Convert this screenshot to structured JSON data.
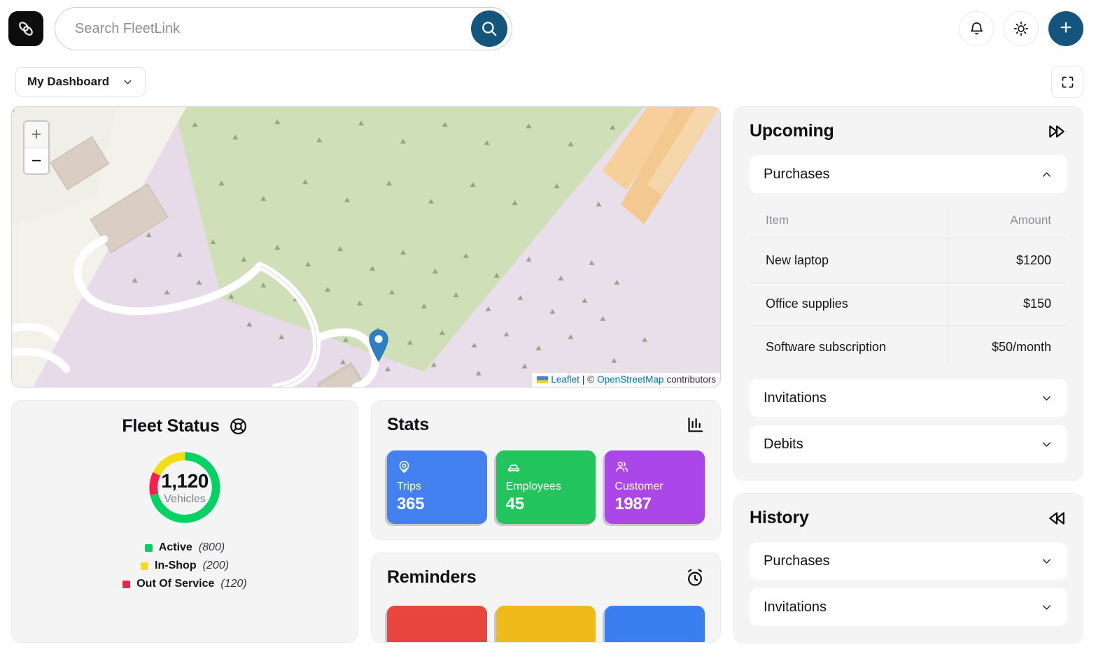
{
  "app": {
    "logo_icon": "chain-link-icon",
    "accent_dark": "#14557e"
  },
  "search": {
    "placeholder": "Search FleetLink",
    "value": "",
    "button_icon": "search-icon"
  },
  "header_actions": [
    {
      "name": "notifications",
      "icon": "bell-icon"
    },
    {
      "name": "theme-toggle",
      "icon": "sun-icon"
    },
    {
      "name": "add",
      "icon": "plus-icon",
      "label": "+"
    }
  ],
  "subheader": {
    "dashboard_select": "My Dashboard",
    "chevron_icon": "chevron-down-icon",
    "fullscreen_icon": "fullscreen-icon"
  },
  "map": {
    "zoom_in": "+",
    "zoom_out": "−",
    "marker_icon": "map-pin-marker",
    "attribution": {
      "flag_icon": "ukraine-flag-icon",
      "leaflet": "Leaflet",
      "separator": " | © ",
      "osm": "OpenStreetMap",
      "suffix": " contributors"
    }
  },
  "fleet_status": {
    "title": "Fleet Status",
    "icon": "lifebuoy-icon",
    "total": "1,120",
    "total_label": "Vehicles",
    "legend": [
      {
        "label": "Active",
        "value": "(800)",
        "color": "#00d263"
      },
      {
        "label": "In-Shop",
        "value": "(200)",
        "color": "#f5dd16"
      },
      {
        "label": "Out Of Service",
        "value": "(120)",
        "color": "#f4214a"
      }
    ]
  },
  "stats": {
    "title": "Stats",
    "icon": "bar-chart-icon",
    "tiles": [
      {
        "label": "Trips",
        "value": "365",
        "color": "#4481f0",
        "icon": "map-pin-check-icon"
      },
      {
        "label": "Employees",
        "value": "45",
        "color": "#21c45d",
        "icon": "car-icon"
      },
      {
        "label": "Customer",
        "value": "1987",
        "color": "#ab47e8",
        "icon": "users-icon"
      }
    ]
  },
  "reminders": {
    "title": "Reminders",
    "icon": "alarm-clock-icon",
    "tiles": [
      {
        "color": "#e8453c"
      },
      {
        "color": "#f0bb1a"
      },
      {
        "color": "#3b7ef0"
      }
    ]
  },
  "upcoming": {
    "title": "Upcoming",
    "icon": "fast-forward-icon",
    "sections": [
      {
        "label": "Purchases",
        "expanded": true,
        "chevron": "chevron-up-icon"
      },
      {
        "label": "Invitations",
        "expanded": false,
        "chevron": "chevron-down-icon"
      },
      {
        "label": "Debits",
        "expanded": false,
        "chevron": "chevron-down-icon"
      }
    ],
    "purchases_table": {
      "columns": [
        "Item",
        "Amount"
      ],
      "rows": [
        {
          "item": "New laptop",
          "amount": "$1200"
        },
        {
          "item": "Office supplies",
          "amount": "$150"
        },
        {
          "item": "Software subscription",
          "amount": "$50/month"
        }
      ]
    }
  },
  "history": {
    "title": "History",
    "icon": "rewind-icon",
    "sections": [
      {
        "label": "Purchases",
        "chevron": "chevron-down-icon"
      },
      {
        "label": "Invitations",
        "chevron": "chevron-down-icon"
      }
    ]
  },
  "chart_data": {
    "type": "pie",
    "title": "Fleet Status",
    "categories": [
      "Active",
      "In-Shop",
      "Out Of Service"
    ],
    "values": [
      800,
      200,
      120
    ],
    "colors": [
      "#00d263",
      "#f5dd16",
      "#f4214a"
    ],
    "total": 1120,
    "center_label": "Vehicles",
    "legend_position": "bottom",
    "donut": true
  }
}
